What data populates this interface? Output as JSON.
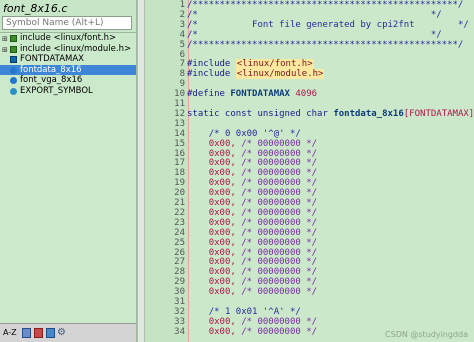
{
  "file_title": "font_8x16.c",
  "search": {
    "placeholder": "Symbol Name (Alt+L)"
  },
  "symbols": [
    {
      "label": "include <linux/font.h>",
      "icon": "include-icon"
    },
    {
      "label": "include <linux/module.h>",
      "icon": "include-icon"
    },
    {
      "label": "FONTDATAMAX",
      "icon": "define-icon"
    },
    {
      "label": "fontdata_8x16",
      "icon": "variable-icon",
      "selected": true
    },
    {
      "label": "font_vga_8x16",
      "icon": "variable-icon"
    },
    {
      "label": "EXPORT_SYMBOL",
      "icon": "function-icon"
    }
  ],
  "bottom_bar": {
    "sort_label": "A-Z"
  },
  "watermark": "CSDN @studyingdda",
  "code": {
    "line_numbers": [
      "1",
      "2",
      "3",
      "4",
      "5",
      "6",
      "7",
      "8",
      "9",
      "10",
      "11",
      "12",
      "13",
      "14",
      "15",
      "16",
      "17",
      "18",
      "19",
      "20",
      "21",
      "22",
      "23",
      "24",
      "25",
      "26",
      "27",
      "28",
      "29",
      "30",
      "31",
      "32",
      "33",
      "34"
    ],
    "banner_rule": "/************************************************",
    "banner_blank1": "/*",
    "banner_text": "/*          Font file generated by cpi2fnt",
    "banner_blank2": "/*",
    "banner_rule_end": "/************************************************",
    "banner_end1": "*/",
    "banner_end2": "*/",
    "banner_end3": "*/",
    "banner_end4": "*/",
    "banner_end5": "*/",
    "include1_kw": "#include",
    "include1_hdr": "<linux/font.h>",
    "include2_kw": "#include",
    "include2_hdr": "<linux/module.h>",
    "define_kw": "#define",
    "define_name": "FONTDATAMAX",
    "define_val": "4096",
    "decl_prefix": "static const unsigned char",
    "decl_name": "fontdata_8x16",
    "decl_bracket": "[FONTDATAMAX]",
    "decl_suffix": " = {",
    "glyph0_comment": "/* 0 0x00 '^@' */",
    "glyph1_comment": "/* 1 0x01 '^A' */",
    "row_value": "0x00,",
    "row_comment": "/* 00000000 */"
  }
}
